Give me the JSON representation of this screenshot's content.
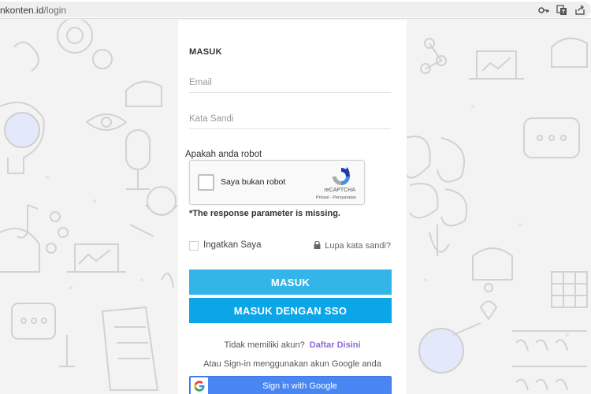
{
  "browser": {
    "url_domain": "nkonten.id",
    "url_path": "/login",
    "icons": [
      "key-icon",
      "translate-icon",
      "share-icon"
    ]
  },
  "login": {
    "title": "MASUK",
    "email_placeholder": "Email",
    "password_placeholder": "Kata Sandi",
    "robot_label": "Apakah anda robot",
    "recaptcha": {
      "checkbox_label": "Saya bukan robot",
      "brand": "reCAPTCHA",
      "links": "Privasi - Persyaratan"
    },
    "error": "*The response parameter is missing.",
    "remember_label": "Ingatkan Saya",
    "forgot_label": "Lupa kata sandi?",
    "login_button": "MASUK",
    "sso_button": "MASUK DENGAN SSO",
    "signup_prompt": "Tidak memiliki akun?",
    "signup_link": "Daftar Disini",
    "google_note": "Atau Sign-in menggunakan akun Google anda",
    "google_button": "Sign in with Google"
  },
  "colors": {
    "login_button": "#33b5e8",
    "sso_button": "#0aa6e8",
    "google_button": "#4a86f2",
    "signup_link": "#8c6ad9"
  }
}
